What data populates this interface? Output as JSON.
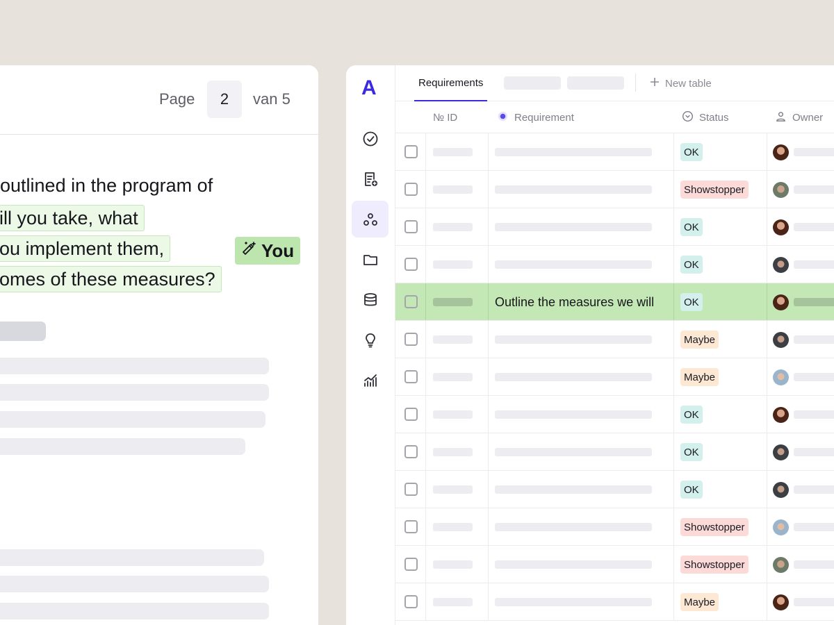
{
  "document": {
    "page_label": "Page",
    "page_current": "2",
    "page_total": "van 5",
    "lines": [
      "outlined in the program of",
      "ill you take, what",
      "ou implement them,",
      "omes of these measures?"
    ],
    "author_tag": "You"
  },
  "app": {
    "logo": "A",
    "nav": [
      "check-circle-icon",
      "add-document-icon",
      "nodes-icon",
      "folder-icon",
      "database-icon",
      "lightbulb-icon",
      "chart-icon"
    ],
    "active_tab": "Requirements",
    "new_table_label": "New table",
    "columns": {
      "id": "№ ID",
      "requirement": "Requirement",
      "status": "Status",
      "owner": "Owner"
    },
    "rows": [
      {
        "status": "OK",
        "status_kind": "ok",
        "avatar": "a1"
      },
      {
        "status": "Showstopper",
        "status_kind": "showstopper",
        "avatar": "a2"
      },
      {
        "status": "OK",
        "status_kind": "ok",
        "avatar": "a1"
      },
      {
        "status": "OK",
        "status_kind": "ok",
        "avatar": "a3"
      },
      {
        "status": "OK",
        "status_kind": "ok",
        "avatar": "a1",
        "selected": true,
        "requirement": "Outline the measures we will"
      },
      {
        "status": "Maybe",
        "status_kind": "maybe",
        "avatar": "a3"
      },
      {
        "status": "Maybe",
        "status_kind": "maybe",
        "avatar": "a4"
      },
      {
        "status": "OK",
        "status_kind": "ok",
        "avatar": "a1"
      },
      {
        "status": "OK",
        "status_kind": "ok",
        "avatar": "a3"
      },
      {
        "status": "OK",
        "status_kind": "ok",
        "avatar": "a3"
      },
      {
        "status": "Showstopper",
        "status_kind": "showstopper",
        "avatar": "a4"
      },
      {
        "status": "Showstopper",
        "status_kind": "showstopper",
        "avatar": "a2"
      },
      {
        "status": "Maybe",
        "status_kind": "maybe",
        "avatar": "a1"
      }
    ]
  },
  "colors": {
    "accent": "#3b2ae0",
    "highlight": "#ebf9e6",
    "selected_row": "#c3e8b5",
    "background": "#e7e2dc"
  }
}
